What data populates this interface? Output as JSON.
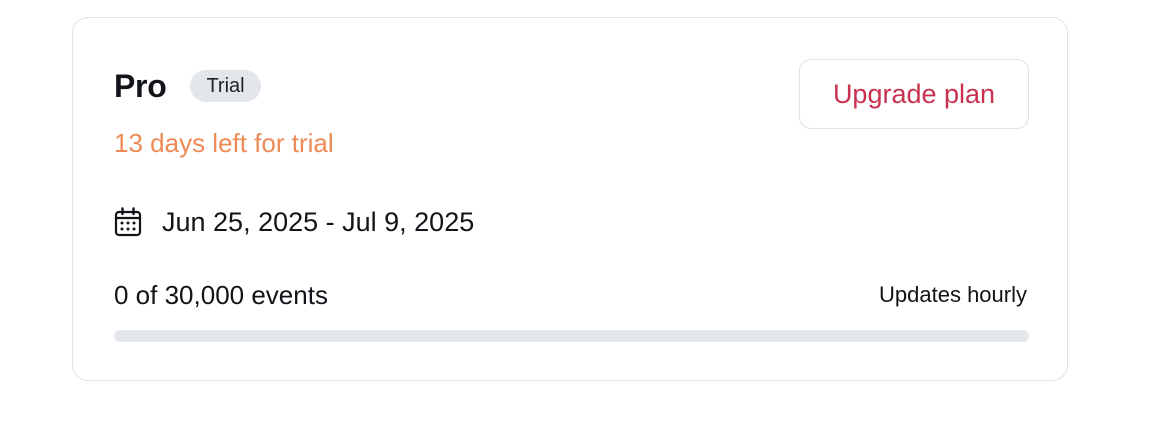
{
  "plan": {
    "name": "Pro",
    "badge": "Trial",
    "trial_remaining": "13 days left for trial"
  },
  "actions": {
    "upgrade_label": "Upgrade plan"
  },
  "period": {
    "range": "Jun 25, 2025 - Jul 9, 2025",
    "icon": "calendar-icon"
  },
  "usage": {
    "summary": "0 of 30,000 events",
    "used": 0,
    "limit": 30000,
    "progress_fraction": 0,
    "update_note": "Updates hourly"
  },
  "colors": {
    "trial_text": "#ee8a55",
    "accent": "#c8314f",
    "badge_bg": "#e3e6ea",
    "track": "#e3e6ea"
  }
}
